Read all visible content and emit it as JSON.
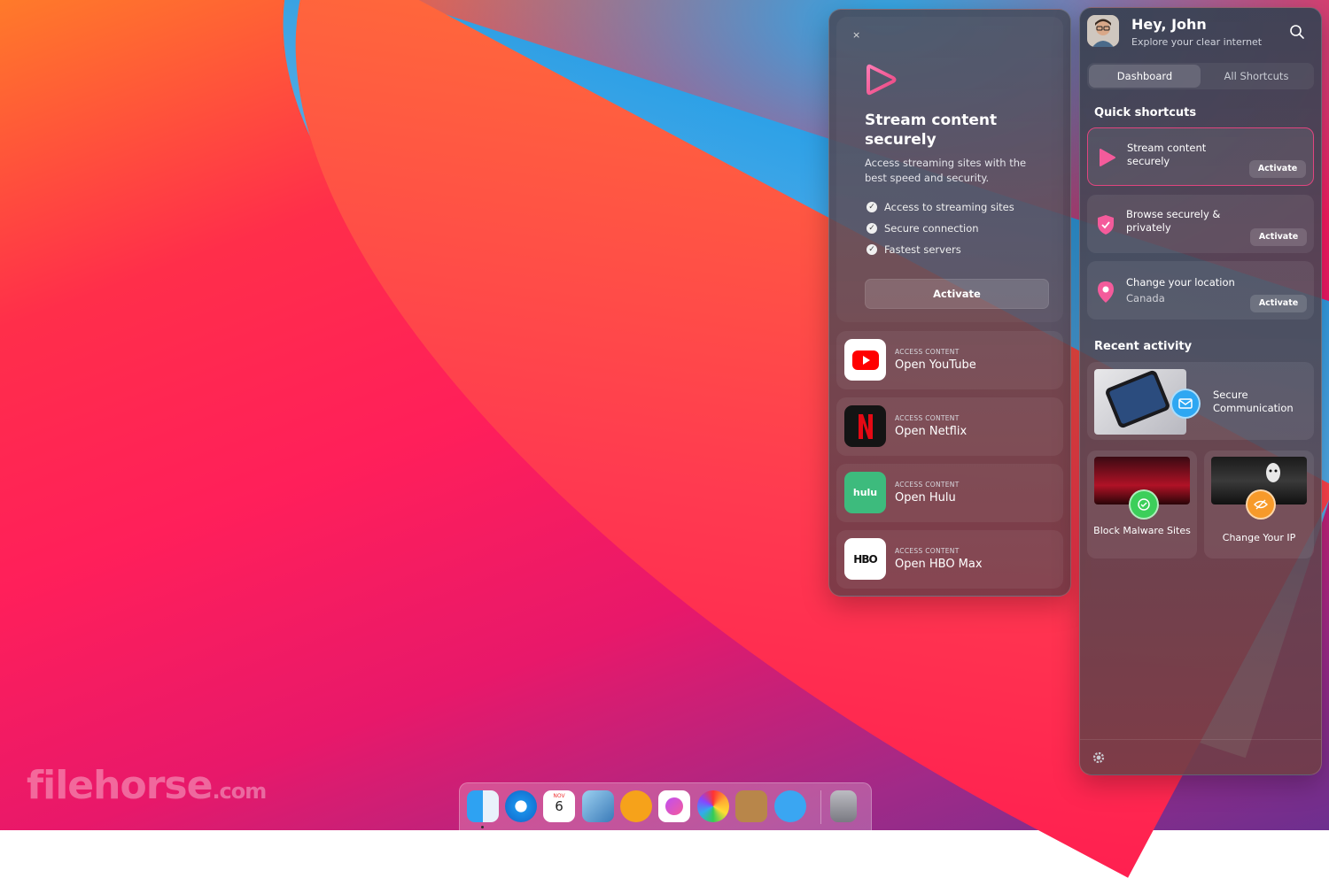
{
  "stream_panel": {
    "close": "×",
    "title": "Stream content securely",
    "description": "Access streaming sites with the best speed and security.",
    "features": [
      "Access to streaming sites",
      "Secure connection",
      "Fastest servers"
    ],
    "activate": "Activate",
    "services": [
      {
        "caption": "ACCESS CONTENT",
        "name": "Open YouTube"
      },
      {
        "caption": "ACCESS CONTENT",
        "name": "Open Netflix"
      },
      {
        "caption": "ACCESS CONTENT",
        "name": "Open Hulu",
        "logo": "hulu"
      },
      {
        "caption": "ACCESS CONTENT",
        "name": "Open HBO Max",
        "logo": "HBO"
      }
    ]
  },
  "dashboard": {
    "greeting": "Hey, John",
    "subtitle": "Explore your clear internet",
    "tabs": [
      "Dashboard",
      "All Shortcuts"
    ],
    "quick_title": "Quick shortcuts",
    "shortcuts": [
      {
        "title": "Stream content securely",
        "sub": "",
        "action": "Activate"
      },
      {
        "title": "Browse securely & privately",
        "sub": "",
        "action": "Activate"
      },
      {
        "title": "Change your location",
        "sub": "Canada",
        "action": "Activate"
      }
    ],
    "recent_title": "Recent activity",
    "recent": [
      {
        "title": "Secure Communication"
      },
      {
        "title": "Block Malware Sites"
      },
      {
        "title": "Change Your IP"
      }
    ]
  },
  "watermark": {
    "main": "filehorse",
    "suffix": ".com"
  },
  "dock_calendar": {
    "month": "NOV",
    "day": "6"
  },
  "colors": {
    "accent": "#e0457f",
    "pink": "#f45b9b"
  }
}
